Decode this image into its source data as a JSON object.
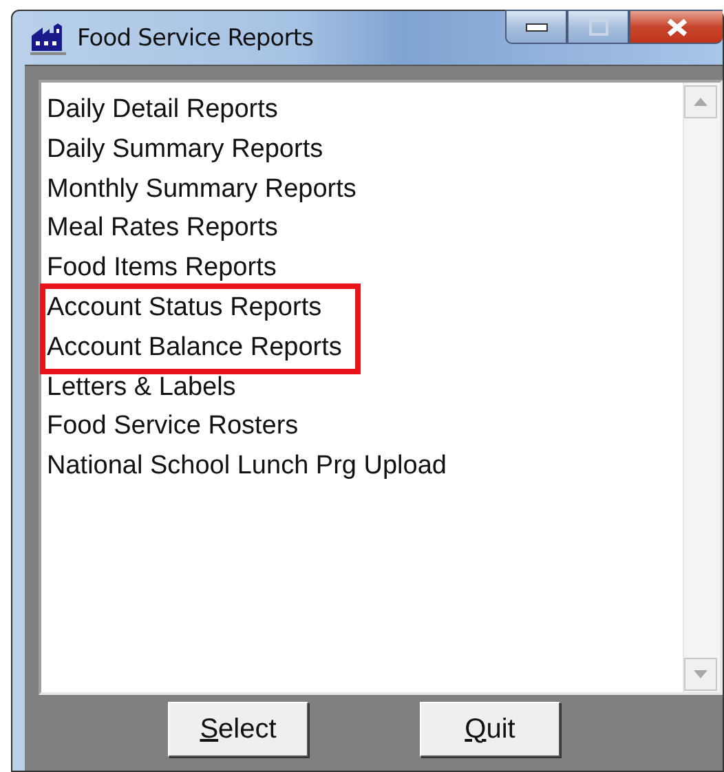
{
  "window": {
    "title": "Food Service Reports"
  },
  "list": {
    "items": [
      {
        "label": "Daily Detail Reports",
        "highlighted": false
      },
      {
        "label": "Daily Summary Reports",
        "highlighted": false
      },
      {
        "label": "Monthly Summary Reports",
        "highlighted": false
      },
      {
        "label": "Meal Rates Reports",
        "highlighted": false
      },
      {
        "label": "Food Items Reports",
        "highlighted": false
      },
      {
        "label": "Account Status Reports",
        "highlighted": true
      },
      {
        "label": "Account Balance Reports",
        "highlighted": true
      },
      {
        "label": "Letters & Labels",
        "highlighted": false
      },
      {
        "label": "Food Service Rosters",
        "highlighted": false
      },
      {
        "label": "National School Lunch Prg Upload",
        "highlighted": false
      }
    ]
  },
  "buttons": [
    {
      "label": "Select"
    },
    {
      "label": "Quit"
    }
  ]
}
